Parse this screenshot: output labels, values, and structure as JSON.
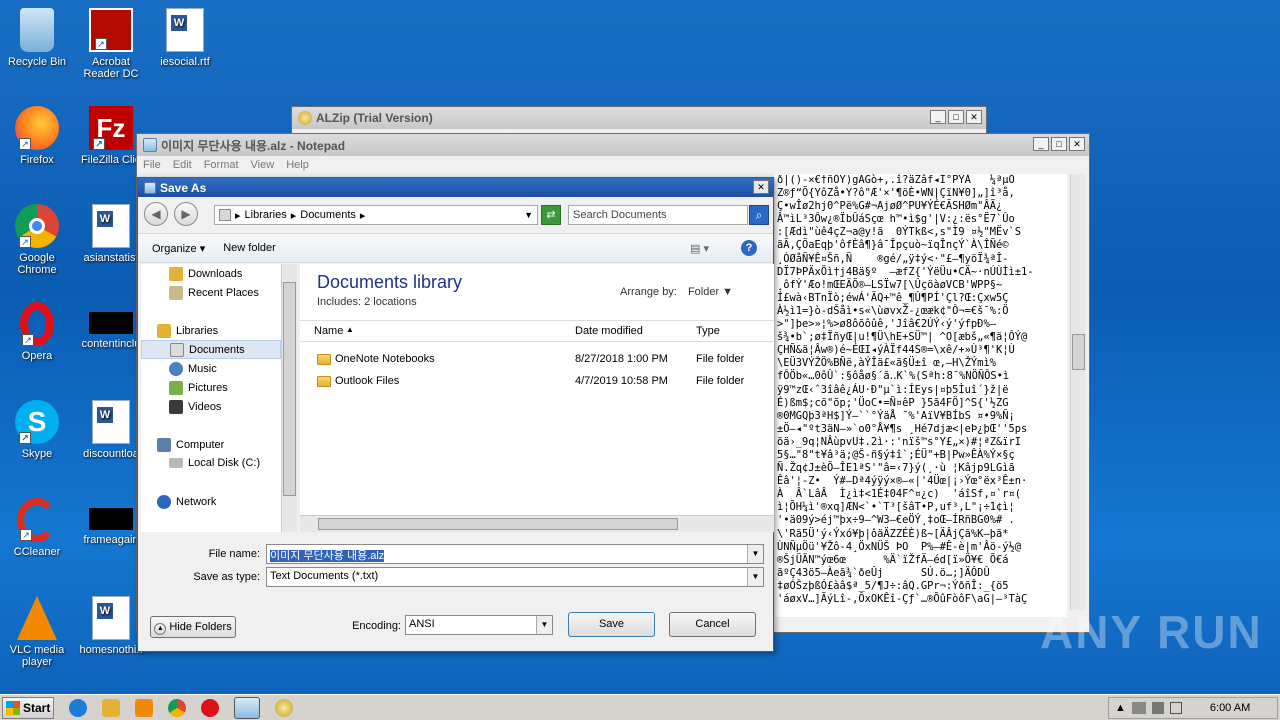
{
  "desktop": {
    "icons": [
      {
        "label": "Recycle Bin"
      },
      {
        "label": "Acrobat Reader DC"
      },
      {
        "label": "iesocial.rtf"
      },
      {
        "label": "Firefox"
      },
      {
        "label": "FileZilla Clie"
      },
      {
        "label": "Google Chrome"
      },
      {
        "label": "asianstatist"
      },
      {
        "label": "Opera"
      },
      {
        "label": "contentinclu"
      },
      {
        "label": "Skype"
      },
      {
        "label": "discountloa"
      },
      {
        "label": "CCleaner"
      },
      {
        "label": "frameagain"
      },
      {
        "label": "VLC media player"
      },
      {
        "label": "homesnothin"
      }
    ]
  },
  "alzip": {
    "title": "ALZip (Trial Version)"
  },
  "notepad": {
    "title": "이미지 무단사용 내용.alz - Notepad",
    "menu": [
      "File",
      "Edit",
      "Format",
      "View",
      "Help"
    ],
    "text": "ð|()-×€†ñÖY)gÃGò+,.î?äZâf◂Ï°PÝÀ   ¼ªµÓ\nZ®ƒ“Õ{YôZå•Y?ô\"Æ'×'¶öÈ•WN|ÇïN¥0]„]î³å,\nÇ•wÎø2hj0^Pë%G#¬AjøØ^PU¥ÝÉ€ÃSHØm\"ÂÃ¿\nÂ™ìL³3Ôw¿®ÏbÛáSçœ h™•ì$g'|V:¿:ës°Ë7`Ûo\n:[Ædì\"ùê4çZ¬a@y!ã  0ÝTkß<,s\"Ì9 ¤½\"MËv`S\nãÃ,ÇÕaEqþ'ôfÈâ¶}â¯Îpçuò~ïqÎnçÝ`À\\ÎÑé©\n¸ÓØåÑ¥Ê¤Šñ,Ñ    ®gé/„ÿ‡ý<·\"£—¶yöÏ¾ªÎ-\nDÏ7ÞPÄxÖì†j4Bä§º  —æfZ{'ÝëÜu•CÄ~·nÚÙÌì±1-\n¸ôfÝ'Æo!mŒEÄÕ®—LSÏw7[\\ÛçöàøVCB'WPP§~\nÍ£wà‹BTnÏò;éwÁ'ÄQ+™ê_¶Û¶PÍ'Çl?Œ:Çxw5Ç\nÀ½ì1=}ò-dŠåì•s«\\ùøvxŽ-¿œæk¢\"Ô¬=€š¯%:Ö\n>\"]þe>»¦%>ø8ôõôûê,'Jîâ€2ÚÝ‹ý'ýfpÐ%—\nš¾•b`;ø‡ÏñyŒ|u!¶Ü\\hE+SÜ™| ^O[æbš„«¶ä¦ÔÝ@\nÇHÑ&ä¦Âw®)é~ÉŒI◂ýÀÏf44S®=\\xê/+»Ù³¶'K¦Ù\n\\EÜ3VÝŽÖ%BÑë,àÝÎä£«ã§Ü±î œ,—H\\ŽÝmì%\nfÔÖb«…0ôÛ`:§ôåø§´ã‥K`%(Sªh:8¯%NÖÑÔS•ì\nÿ9™zŒ‹ˆ3îâê¿ÁU·Ð\"µ`ì:ÍEys|¤þ5Ìuî´}ž|ë\nÉ)ßm$;cõ\"õp;'ÜoC•=Ñ¤êP }5ã4FÖ]^S{'½ZG\n®0MGQþ3ªH$]Ý–``°ÝäÅ ¯%'AïV¥BÍbS ¤•9%Ñ¡\n±Ö–◂\"ºt3äN–»`o0°Å¥¶s ¸Hé7djæ<|eÞ¿þŒ''5ps\nõä›_9q¦NÂùpvU‡.2ì·:'nïš™s°Y£„×)#¦ªZ&ïrI\n5§…\"8\"t¥â³ä;@Š-ñ§ý‡î`;ÉÜ\"+B|Pw»ÊÀ%Ý×§ç\nÑ.Žq¢J±èÖ–ÎE1ªS'\"â=‹7}ý(¸·ù ¦Kâjp9LGìã\nÊâ'¦-Z•  Ý#–Dª4ýÿý×®—«|'4Üœ|¡›Ýœ°ëx³Ê±n·\nÀ  Â`LâÂ  Ì¿ì‡<1É‡04F^¤¿c)  'áîSf,¤`r¤(\nì¦ÕH¼ì'®xq]ÆN<`•`T³[šâT•P,uf³,L\"¡÷1¢ì¦\n'•ä09ý>éj™þx÷9—^W3—€eÖÝ¸‡oŒ—ÍRñBG0%# .\n\\'Rä5Ü'ý‹Ýxó¥þ|ôäÄZZÉÈ)ß~[ÄÂjÇã%K—þã*\nÙNÑµÖü'¥Žô-4¸ÖxNÜŠ ÞO  P%—#Ê-è|m'Âö-ý½@\n®ŠjÜÄN™ýœ6œ      %Ä`ïŽfÄ—éd[ï»Ö¥€ Õ€á\nãºÇ43ö5—Àeã¾`ðeÛj      SÚ.ö…;]ÄÔDÛ\n‡øÓŠzþßÓ£àâ$ª_5/¶J÷:âQ.GPr¬:ÝðñÎ:_{ö5\n'áøxV…]ÃýLî-,ÔxOKÊî-Çƒ`…®ÕûFòôF\\aG|—³TàÇ"
  },
  "dialog": {
    "title": "Save As",
    "breadcrumb": [
      "Libraries",
      "Documents"
    ],
    "search_placeholder": "Search Documents",
    "organize": "Organize",
    "new_folder": "New folder",
    "nav": {
      "downloads": "Downloads",
      "recent": "Recent Places",
      "libraries": "Libraries",
      "documents": "Documents",
      "music": "Music",
      "pictures": "Pictures",
      "videos": "Videos",
      "computer": "Computer",
      "local_disk": "Local Disk (C:)",
      "network": "Network"
    },
    "library_title": "Documents library",
    "library_sub": "Includes:  2 locations",
    "arrange_label": "Arrange by:",
    "arrange_value": "Folder",
    "columns": {
      "name": "Name",
      "date": "Date modified",
      "type": "Type"
    },
    "files": [
      {
        "name": "OneNote Notebooks",
        "date": "8/27/2018 1:00 PM",
        "type": "File folder"
      },
      {
        "name": "Outlook Files",
        "date": "4/7/2019 10:58 PM",
        "type": "File folder"
      }
    ],
    "filename_label": "File name:",
    "filename_value": "이미지 무단사용 내용.alz",
    "savetype_label": "Save as type:",
    "savetype_value": "Text Documents (*.txt)",
    "encoding_label": "Encoding:",
    "encoding_value": "ANSI",
    "hide_folders": "Hide Folders",
    "save": "Save",
    "cancel": "Cancel"
  },
  "taskbar": {
    "start": "Start",
    "clock": "6:00 AM"
  },
  "watermark": "ANY RUN"
}
